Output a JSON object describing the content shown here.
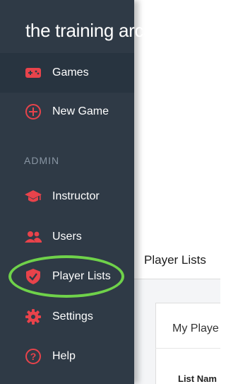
{
  "brand": {
    "name": "the training arcade",
    "trademark": "®"
  },
  "sidebar": {
    "items": [
      {
        "label": "Games",
        "icon": "gamepad-icon",
        "active": true
      },
      {
        "label": "New Game",
        "icon": "plus-circle-icon"
      },
      {
        "label": "Instructor",
        "icon": "graduation-cap-icon"
      },
      {
        "label": "Users",
        "icon": "users-icon"
      },
      {
        "label": "Player Lists",
        "icon": "shield-check-icon"
      },
      {
        "label": "Settings",
        "icon": "gear-icon"
      },
      {
        "label": "Help",
        "icon": "question-circle-icon"
      }
    ],
    "section_label": "ADMIN"
  },
  "main": {
    "page_title": "Player Lists",
    "card_title": "My Playe",
    "column_header": "List Nam"
  },
  "colors": {
    "sidebar_bg": "#2f3a46",
    "accent": "#e8434b",
    "highlight": "#6fd24a"
  }
}
